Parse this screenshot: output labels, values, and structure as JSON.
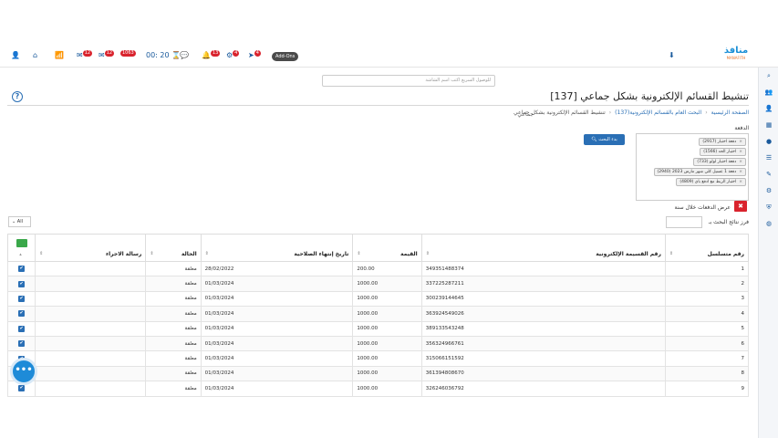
{
  "topbar": {
    "logo_text": "منافذ",
    "logo_sub": "MANAFITH",
    "addon_label": "Add-Ons",
    "timer": "00: 20",
    "badges": [
      "13",
      "4",
      "12",
      "12"
    ],
    "dark_badge": "1063"
  },
  "search": {
    "placeholder": "للوصول السريع اكتب اسم الشاشة"
  },
  "page": {
    "title": "تنشيط القسائم الإلكترونية بشكل جماعي [137]",
    "breadcrumb": {
      "home": "الصفحة الرئيسية",
      "search": "البحث العام بالقسائم الإلكترونية(137)",
      "current": "تنشيط القسائم الإلكترونية بشكل جماعي"
    },
    "subtitle": "جماعي"
  },
  "filters": {
    "batch_label": "الدفعة",
    "batches": [
      "دفعة اختبار (2917)",
      "اختبار الحد (1566)",
      "دفعة اختبار لولو (733)",
      "دفعة 1 عسيل كلي شهر مارس 2023 (2940)",
      "اختبار الربط مع ادفع باي (4809)"
    ],
    "search_button": "بدء البحث",
    "year_label": "عرض الدفعات خلال سنة",
    "sort_label": "فرز نتائج البحث بـ",
    "page_size": "All"
  },
  "table": {
    "headers": {
      "serial": "رقم متسلسل",
      "voucher": "رقم القسيمة الإلكترونية",
      "value": "القيمة",
      "expiry": "تاريخ إنتهاء الصلاحية",
      "status": "الحالة",
      "message": "رسالة الاجراء"
    },
    "rows": [
      {
        "serial": "1",
        "voucher": "349351488374",
        "value": "200.00",
        "expiry": "28/02/2022",
        "status": "معلقة",
        "message": ""
      },
      {
        "serial": "2",
        "voucher": "337225287211",
        "value": "1000.00",
        "expiry": "01/03/2024",
        "status": "معلقة",
        "message": ""
      },
      {
        "serial": "3",
        "voucher": "300239144645",
        "value": "1000.00",
        "expiry": "01/03/2024",
        "status": "معلقة",
        "message": ""
      },
      {
        "serial": "4",
        "voucher": "363924549026",
        "value": "1000.00",
        "expiry": "01/03/2024",
        "status": "معلقة",
        "message": ""
      },
      {
        "serial": "5",
        "voucher": "389133543248",
        "value": "1000.00",
        "expiry": "01/03/2024",
        "status": "معلقة",
        "message": ""
      },
      {
        "serial": "6",
        "voucher": "356324966761",
        "value": "1000.00",
        "expiry": "01/03/2024",
        "status": "معلقة",
        "message": ""
      },
      {
        "serial": "7",
        "voucher": "315066151592",
        "value": "1000.00",
        "expiry": "01/03/2024",
        "status": "معلقة",
        "message": ""
      },
      {
        "serial": "8",
        "voucher": "361394808670",
        "value": "1000.00",
        "expiry": "01/03/2024",
        "status": "معلقة",
        "message": ""
      },
      {
        "serial": "9",
        "voucher": "326246036792",
        "value": "1000.00",
        "expiry": "01/03/2024",
        "status": "معلقة",
        "message": ""
      }
    ]
  },
  "colors": {
    "primary": "#2a6fb5",
    "danger": "#d9232d",
    "success": "#3aa84a"
  }
}
